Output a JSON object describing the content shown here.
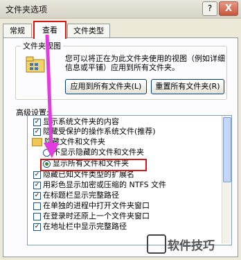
{
  "window": {
    "title": "文件夹选项",
    "help_label": "?",
    "close_label": "X"
  },
  "tabs": [
    {
      "label": "常规",
      "active": false
    },
    {
      "label": "查看",
      "active": true
    },
    {
      "label": "文件类型",
      "active": false
    }
  ],
  "folder_views": {
    "group_title": "文件夹视图",
    "description": "您可以将正在为此文件夹使用的视图（例如详细信息或平铺）应用到所有文件夹。",
    "apply_label": "应用到所有文件夹(L)",
    "reset_label": "重置所有文件夹(R)"
  },
  "advanced": {
    "label": "高级设置:",
    "items": [
      {
        "kind": "checkbox",
        "checked": true,
        "label": "显示系统文件夹的内容"
      },
      {
        "kind": "checkbox",
        "checked": true,
        "label": "隐藏受保护的操作系统文件(推荐)"
      },
      {
        "kind": "folder",
        "label": "隐藏文件和文件夹"
      },
      {
        "kind": "radio",
        "checked": false,
        "label": "不显示隐藏的文件和文件夹"
      },
      {
        "kind": "radio",
        "checked": true,
        "label": "显示所有文件和文件夹"
      },
      {
        "kind": "checkbox",
        "checked": true,
        "label": "隐藏已知文件类型的扩展名"
      },
      {
        "kind": "checkbox",
        "checked": true,
        "label": "用彩色显示加密或压缩的 NTFS 文件"
      },
      {
        "kind": "checkbox",
        "checked": true,
        "label": "在标题栏显示完整路径"
      },
      {
        "kind": "checkbox",
        "checked": false,
        "label": "在单独的进程中打开文件夹窗口"
      },
      {
        "kind": "checkbox",
        "checked": false,
        "label": "在登录时还原上一个文件夹窗口"
      },
      {
        "kind": "checkbox",
        "checked": true,
        "label": "在地址栏中显示完整路径"
      }
    ]
  },
  "watermark": "软件技巧",
  "colors": {
    "annotation": "#d91616",
    "arrow": "#e03ce0"
  }
}
